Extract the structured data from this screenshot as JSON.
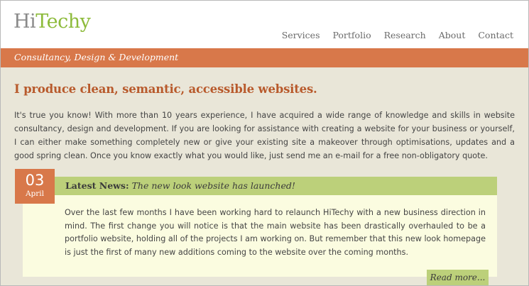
{
  "header": {
    "logo_part1": "Hi",
    "logo_part2": "Techy",
    "nav": [
      "Services",
      "Portfolio",
      "Research",
      "About",
      "Contact"
    ]
  },
  "tagline": "Consultancy, Design & Development",
  "main": {
    "headline": "I produce clean, semantic, accessible websites.",
    "intro": "It's true you know! With more than 10 years experience, I have acquired a wide range of knowledge and skills in website consultancy, design and development. If you are looking for assistance with creating a website for your business or yourself, I can either make something completely new or give your existing site a makeover through optimisations, updates and a good spring clean. Once you know exactly what you would like, just send me an e-mail for a free non-obligatory quote."
  },
  "news": {
    "date_day": "03",
    "date_month": "April",
    "label": "Latest News:",
    "title": "The new look website has launched!",
    "body": "Over the last few months I have been working hard to relaunch HiTechy with a new business direction in mind. The first change you will notice is that the main website has been drastically overhauled to be a portfolio website, holding all of the projects I am working on. But remember that this new look homepage is just the first of many new additions coming to the website over the coming months.",
    "read_more": "Read more..."
  },
  "colors": {
    "background": "#e9e6d8",
    "accent_orange": "#d8784a",
    "headline_orange": "#b85a2c",
    "accent_green": "#8dbb3b",
    "news_green": "#bcd07a",
    "news_body": "#fbfce0"
  }
}
